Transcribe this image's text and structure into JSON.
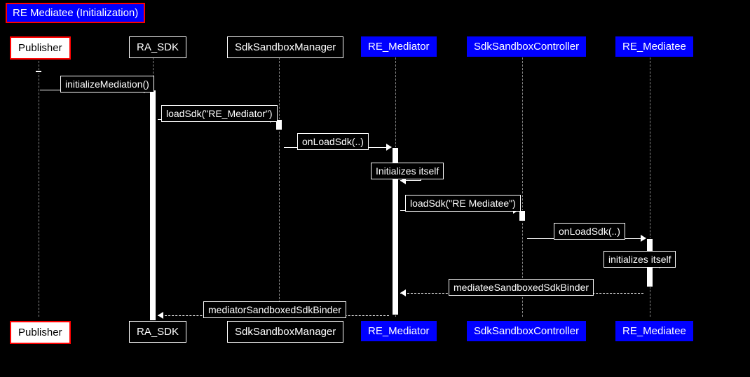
{
  "title": "RE Mediatee (Initialization)",
  "participants": {
    "publisher": "Publisher",
    "ra_sdk": "RA_SDK",
    "sdk_sandbox_manager": "SdkSandboxManager",
    "re_mediator": "RE_Mediator",
    "sdk_sandbox_controller": "SdkSandboxController",
    "re_mediatee": "RE_Mediatee"
  },
  "messages": {
    "m1": "initializeMediation()",
    "m2": "loadSdk(\"RE_Mediator\")",
    "m3": "onLoadSdk(..)",
    "m4": "Initializes itself",
    "m5": "loadSdk(\"RE Mediatee\")",
    "m6": "onLoadSdk(..)",
    "m7": "initializes itself",
    "m8": "mediateeSandboxedSdkBinder",
    "m9": "mediatorSandboxedSdkBinder"
  },
  "chart_data": {
    "type": "sequence-diagram",
    "title": "RE Mediatee (Initialization)",
    "participants": [
      "Publisher",
      "RA_SDK",
      "SdkSandboxManager",
      "RE_Mediator",
      "SdkSandboxController",
      "RE_Mediatee"
    ],
    "participant_styles": {
      "Publisher": "white-red-border",
      "RA_SDK": "black-white-border",
      "SdkSandboxManager": "black-white-border",
      "RE_Mediator": "blue",
      "SdkSandboxController": "blue",
      "RE_Mediatee": "blue"
    },
    "messages": [
      {
        "from": "Publisher",
        "to": "RA_SDK",
        "label": "initializeMediation()",
        "type": "sync"
      },
      {
        "from": "RA_SDK",
        "to": "SdkSandboxManager",
        "label": "loadSdk(\"RE_Mediator\")",
        "type": "sync"
      },
      {
        "from": "SdkSandboxManager",
        "to": "RE_Mediator",
        "label": "onLoadSdk(..)",
        "type": "sync"
      },
      {
        "from": "RE_Mediator",
        "to": "RE_Mediator",
        "label": "Initializes itself",
        "type": "self"
      },
      {
        "from": "RE_Mediator",
        "to": "SdkSandboxController",
        "label": "loadSdk(\"RE Mediatee\")",
        "type": "sync"
      },
      {
        "from": "SdkSandboxController",
        "to": "RE_Mediatee",
        "label": "onLoadSdk(..)",
        "type": "sync"
      },
      {
        "from": "RE_Mediatee",
        "to": "RE_Mediatee",
        "label": "initializes itself",
        "type": "self"
      },
      {
        "from": "RE_Mediatee",
        "to": "RE_Mediator",
        "label": "mediateeSandboxedSdkBinder",
        "type": "return"
      },
      {
        "from": "RE_Mediator",
        "to": "RA_SDK",
        "label": "mediatorSandboxedSdkBinder",
        "type": "return"
      }
    ]
  }
}
